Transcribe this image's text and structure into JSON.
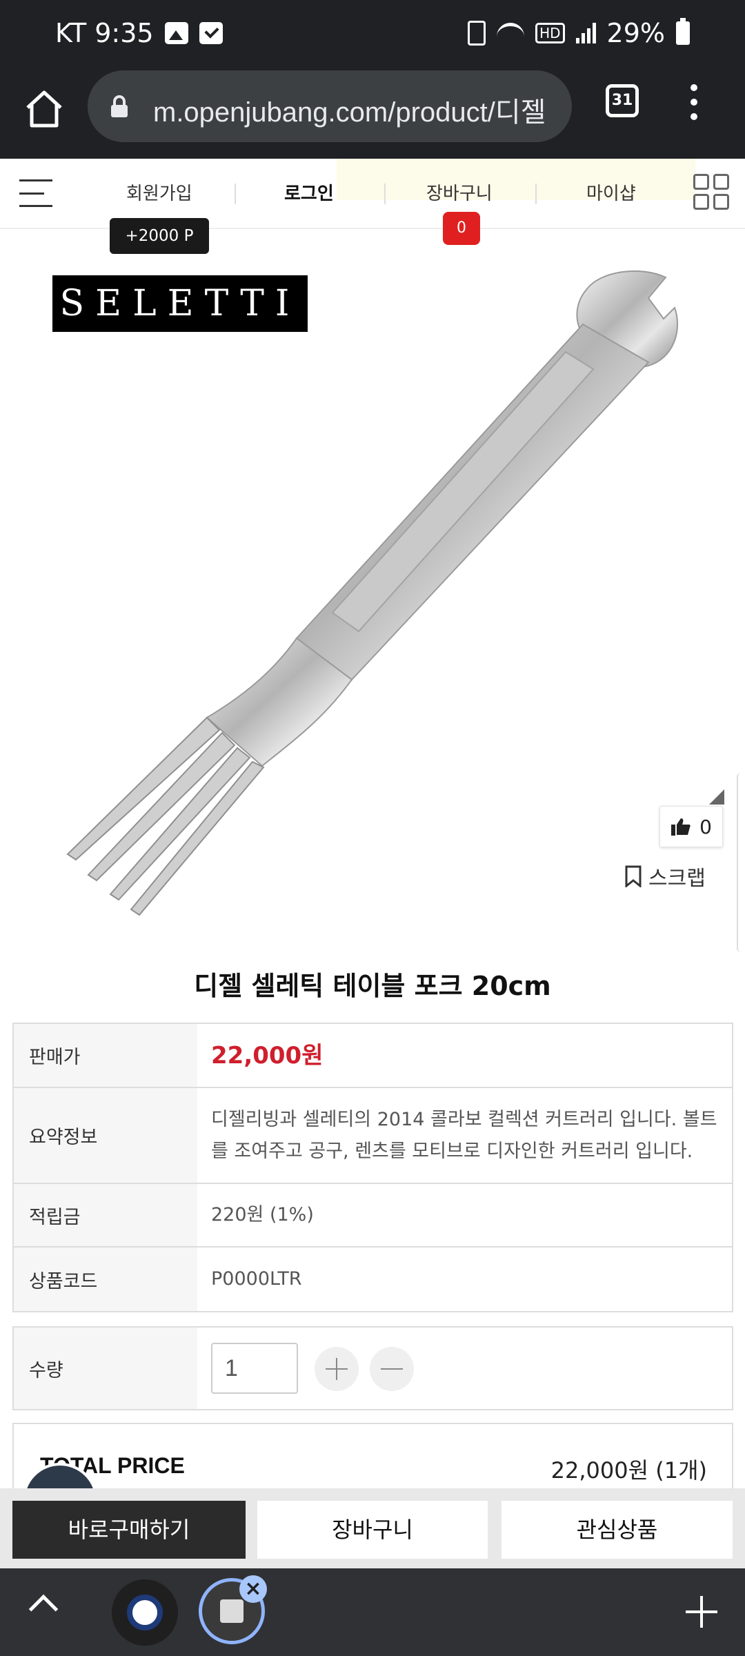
{
  "status_bar": {
    "carrier_time": "KT 9:35",
    "battery": "29%",
    "network_label": "HD"
  },
  "browser": {
    "url": "m.openjubang.com/product/디젤",
    "tab_count": "31"
  },
  "site_nav": {
    "signup": "회원가입",
    "login": "로그인",
    "cart": "장바구니",
    "myshop": "마이샵",
    "points_badge": "+2000 P",
    "cart_count": "0"
  },
  "product": {
    "brand_logo": "SELETTI",
    "likes": "0",
    "scrap_label": "스크랩",
    "title": "디젤 셀레틱 테이블 포크 20cm"
  },
  "info_table": {
    "rows": [
      {
        "label": "판매가",
        "value": "22,000원"
      },
      {
        "label": "요약정보",
        "value": "디젤리빙과 셀레티의 2014 콜라보 컬렉션 커트러리 입니다. 볼트를 조여주고 공구, 렌츠를 모티브로 디자인한 커트러리 입니다."
      },
      {
        "label": "적립금",
        "value": "220원 (1%)"
      },
      {
        "label": "상품코드",
        "value": "P0000LTR"
      }
    ]
  },
  "quantity": {
    "label": "수량",
    "value": "1"
  },
  "total": {
    "label": "TOTAL PRICE",
    "value": "22,000원 (1개)"
  },
  "actions": {
    "buy_now": "바로구매하기",
    "cart": "장바구니",
    "wishlist": "관심상품"
  },
  "colors": {
    "price_red": "#cf1f2d",
    "badge_red": "#e02020",
    "browser_dark": "#202124"
  },
  "icons": [
    "home-icon",
    "lock-icon",
    "menu-icon",
    "grid-icon",
    "thumbs-up-icon",
    "bookmark-icon",
    "plus-icon",
    "minus-icon",
    "chevron-up-icon",
    "close-icon"
  ]
}
